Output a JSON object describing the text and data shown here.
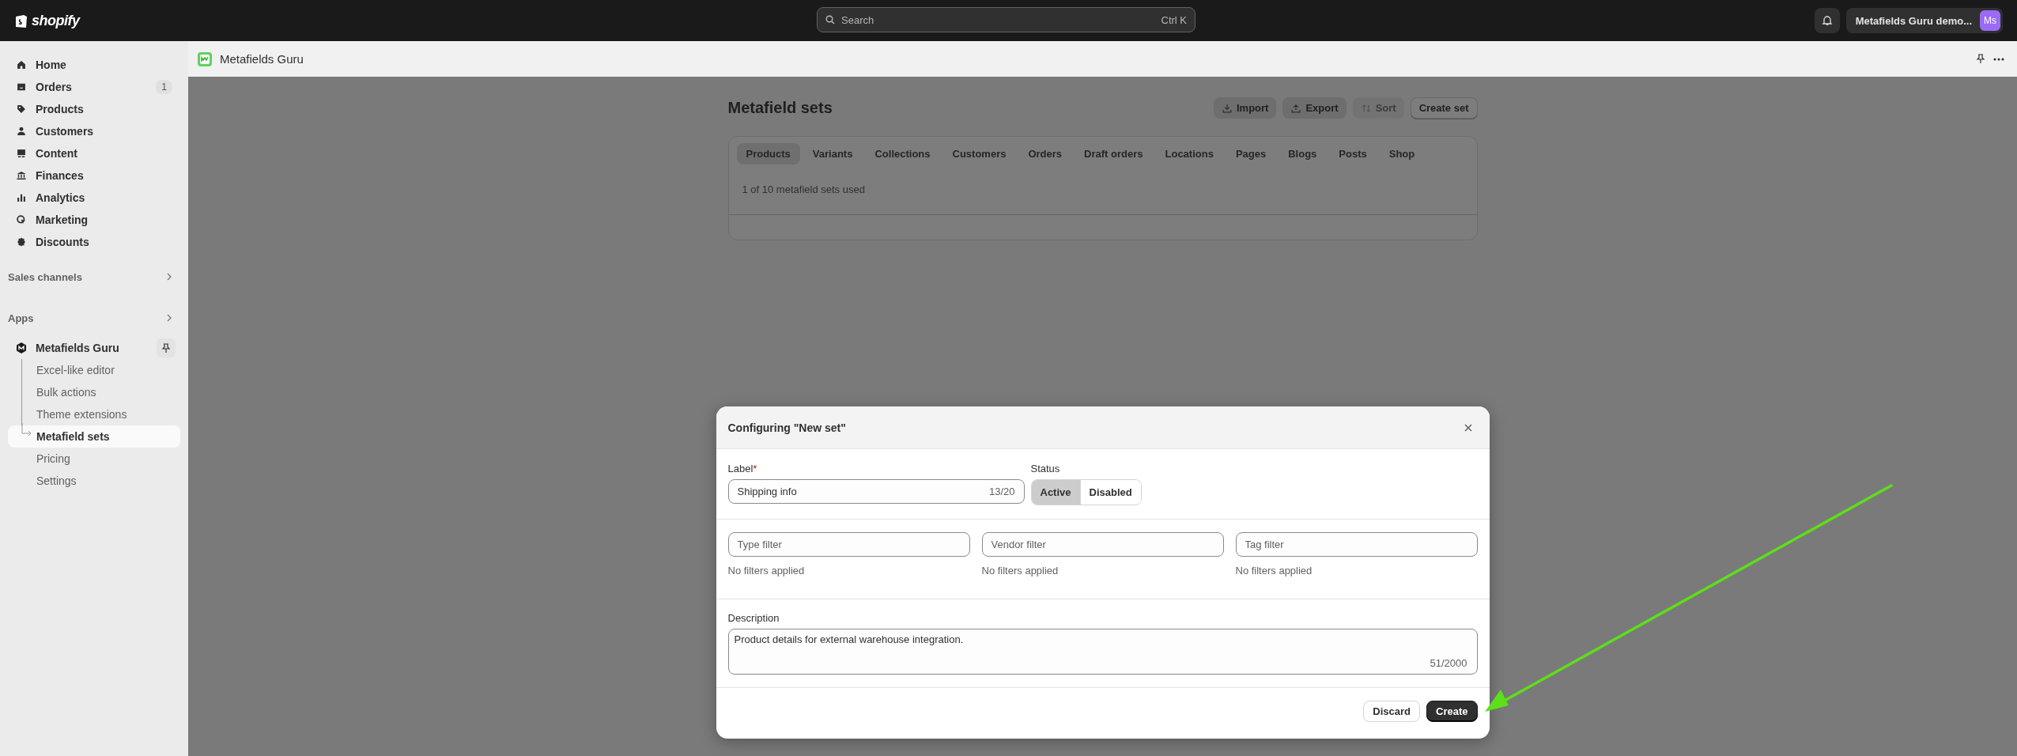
{
  "top_bar": {
    "logo": "shopify",
    "search": {
      "placeholder": "Search",
      "shortcut": "Ctrl K"
    },
    "store": {
      "name": "Metafields Guru demo...",
      "avatar": "Ms"
    }
  },
  "sidebar": {
    "items": [
      {
        "label": "Home",
        "selected": false
      },
      {
        "label": "Orders",
        "badge": "1",
        "selected": false
      },
      {
        "label": "Products",
        "selected": false
      },
      {
        "label": "Customers",
        "selected": false
      },
      {
        "label": "Content",
        "selected": false
      },
      {
        "label": "Finances",
        "selected": false
      },
      {
        "label": "Analytics",
        "selected": false
      },
      {
        "label": "Marketing",
        "selected": false
      },
      {
        "label": "Discounts",
        "selected": false
      }
    ],
    "sections": [
      {
        "label": "Sales channels"
      },
      {
        "label": "Apps"
      }
    ],
    "app": {
      "name": "Metafields Guru",
      "children": [
        {
          "label": "Excel-like editor",
          "selected": false
        },
        {
          "label": "Bulk actions",
          "selected": false
        },
        {
          "label": "Theme extensions",
          "selected": false
        },
        {
          "label": "Metafield sets",
          "selected": true
        },
        {
          "label": "Pricing",
          "selected": false
        },
        {
          "label": "Settings",
          "selected": false
        }
      ]
    }
  },
  "app_header": {
    "title": "Metafields Guru"
  },
  "page": {
    "title": "Metafield sets",
    "actions": [
      {
        "label": "Import",
        "kind": "import",
        "disabled": false
      },
      {
        "label": "Export",
        "kind": "export",
        "disabled": false
      },
      {
        "label": "Sort",
        "kind": "sort",
        "disabled": true
      },
      {
        "label": "Create set",
        "kind": "plain",
        "disabled": false
      }
    ],
    "tabs": [
      {
        "label": "Products",
        "selected": true
      },
      {
        "label": "Variants",
        "selected": false
      },
      {
        "label": "Collections",
        "selected": false
      },
      {
        "label": "Customers",
        "selected": false
      },
      {
        "label": "Orders",
        "selected": false
      },
      {
        "label": "Draft orders",
        "selected": false
      },
      {
        "label": "Locations",
        "selected": false
      },
      {
        "label": "Pages",
        "selected": false
      },
      {
        "label": "Blogs",
        "selected": false
      },
      {
        "label": "Posts",
        "selected": false
      },
      {
        "label": "Shop",
        "selected": false
      }
    ],
    "usage": "1 of 10 metafield sets used"
  },
  "modal": {
    "title": "Configuring \"New set\"",
    "label_field": {
      "label": "Label",
      "required_mark": "*",
      "value": "Shipping info",
      "counter": "13/20"
    },
    "status": {
      "label": "Status",
      "options": [
        {
          "label": "Active",
          "selected": true
        },
        {
          "label": "Disabled",
          "selected": false
        }
      ]
    },
    "filters": [
      {
        "placeholder": "Type filter",
        "note": "No filters applied"
      },
      {
        "placeholder": "Vendor filter",
        "note": "No filters applied"
      },
      {
        "placeholder": "Tag filter",
        "note": "No filters applied"
      }
    ],
    "description": {
      "label": "Description",
      "value": "Product details for external warehouse integration.",
      "counter": "51/2000"
    },
    "buttons": [
      {
        "label": "Discard",
        "kind": "secondary"
      },
      {
        "label": "Create",
        "kind": "primary"
      }
    ]
  }
}
